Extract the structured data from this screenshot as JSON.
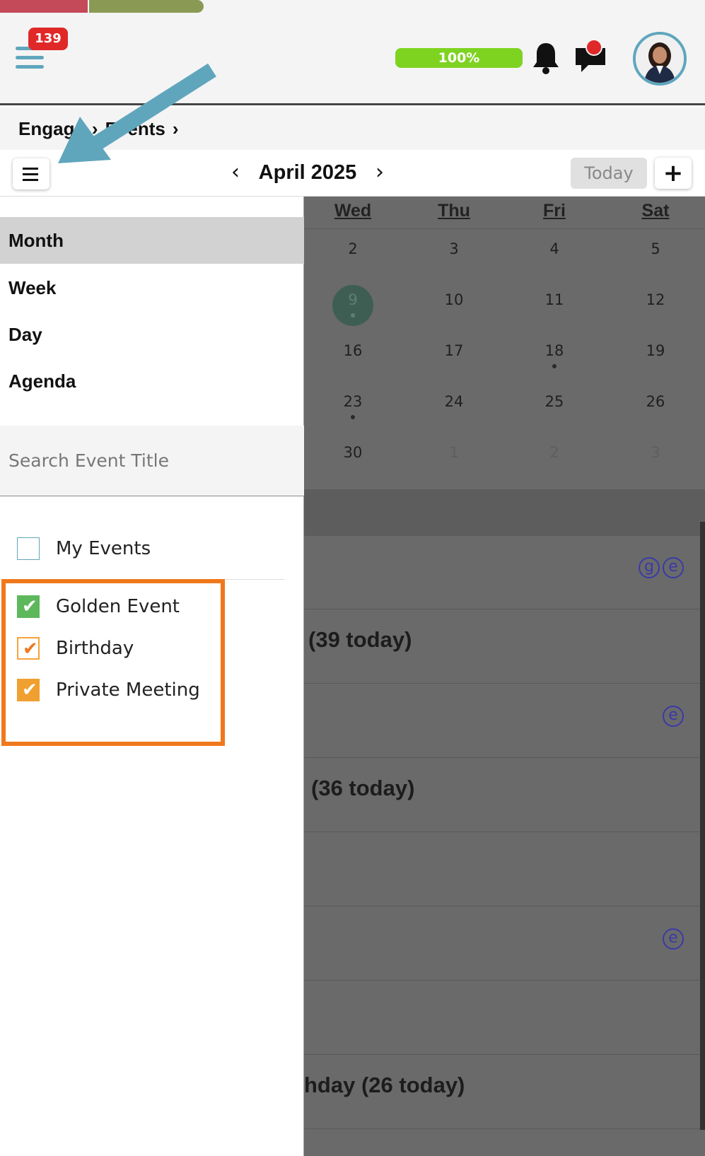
{
  "header": {
    "notification_count": "139",
    "completion": "100%",
    "colors": {
      "accent": "#5fa6bd",
      "badge": "#e02828",
      "progress": "#7ed321"
    }
  },
  "breadcrumb": {
    "items": [
      "Engage",
      "Events"
    ]
  },
  "toolbar": {
    "month_label": "April 2025",
    "today_label": "Today",
    "add_label": "+"
  },
  "sidebar": {
    "views": [
      {
        "label": "Month",
        "active": true
      },
      {
        "label": "Week"
      },
      {
        "label": "Day"
      },
      {
        "label": "Agenda"
      }
    ],
    "search_placeholder": "Search Event Title",
    "filters": [
      {
        "label": "My Events",
        "checked": false
      },
      {
        "label": "Golden Event",
        "checked": true,
        "color": "#5db85c"
      },
      {
        "label": "Birthday",
        "checked": true,
        "color": "#f07820"
      },
      {
        "label": "Private Meeting",
        "checked": true,
        "color": "#f0a030"
      }
    ]
  },
  "calendar": {
    "weekdays": [
      "Wed",
      "Thu",
      "Fri",
      "Sat"
    ],
    "weeks": [
      [
        "2",
        "3",
        "4",
        "5"
      ],
      [
        "9",
        "10",
        "11",
        "12"
      ],
      [
        "16",
        "17",
        "18",
        "19"
      ],
      [
        "23",
        "24",
        "25",
        "26"
      ],
      [
        "30",
        "1",
        "2",
        "3"
      ]
    ],
    "today": "9",
    "events": [
      {
        "text": "",
        "icons": [
          "g",
          "e"
        ]
      },
      {
        "text": "(39 today)",
        "icons": []
      },
      {
        "text": "",
        "icons": [
          "e"
        ]
      },
      {
        "text": "(36 today)",
        "icons": []
      },
      {
        "text": "",
        "icons": []
      },
      {
        "text": "",
        "icons": [
          "e"
        ]
      },
      {
        "text": "",
        "icons": []
      },
      {
        "text": "hday (26 today)",
        "icons": []
      }
    ]
  }
}
